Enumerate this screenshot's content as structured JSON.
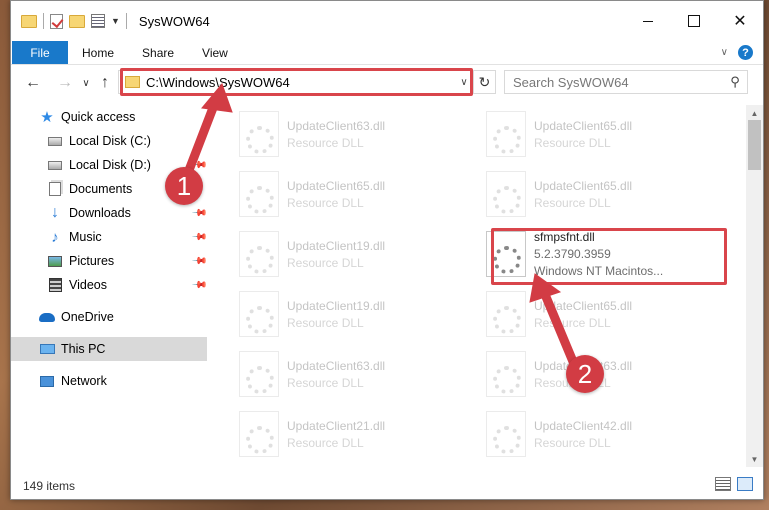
{
  "window": {
    "title": "SysWOW64"
  },
  "ribbon": {
    "file": "File",
    "home": "Home",
    "share": "Share",
    "view": "View"
  },
  "address": {
    "path": "C:\\Windows\\SysWOW64"
  },
  "search": {
    "placeholder": "Search SysWOW64"
  },
  "sidebar": {
    "items": [
      {
        "label": "Quick access"
      },
      {
        "label": "Local Disk (C:)"
      },
      {
        "label": "Local Disk (D:)"
      },
      {
        "label": "Documents"
      },
      {
        "label": "Downloads"
      },
      {
        "label": "Music"
      },
      {
        "label": "Pictures"
      },
      {
        "label": "Videos"
      },
      {
        "label": "OneDrive"
      },
      {
        "label": "This PC"
      },
      {
        "label": "Network"
      }
    ]
  },
  "files": [
    {
      "name": "UpdateClient63.dll",
      "sub": "Resource DLL"
    },
    {
      "name": "UpdateClient65.dll",
      "sub": "Resource DLL"
    },
    {
      "name": "UpdateClient65.dll",
      "sub": "Resource DLL"
    },
    {
      "name": "UpdateClient65.dll",
      "sub": "Resource DLL"
    },
    {
      "name": "UpdateClient19.dll",
      "sub": "Resource DLL"
    },
    {
      "name": "sfmpsfnt.dll",
      "version": "5.2.3790.3959",
      "desc": "Windows NT Macintos..."
    },
    {
      "name": "UpdateClient19.dll",
      "sub": "Resource DLL"
    },
    {
      "name": "UpdateClient65.dll",
      "sub": "Resource DLL"
    },
    {
      "name": "UpdateClient63.dll",
      "sub": "Resource DLL"
    },
    {
      "name": "UpdateClient63.dll",
      "sub": "Resource DLL"
    },
    {
      "name": "UpdateClient21.dll",
      "sub": "Resource DLL"
    },
    {
      "name": "UpdateClient42.dll",
      "sub": "Resource DLL"
    }
  ],
  "status": {
    "count": "149 items"
  },
  "markers": {
    "one": "1",
    "two": "2"
  },
  "colors": {
    "accent": "#1979ca",
    "highlight": "#d9454b",
    "selection": "#cce8ff"
  }
}
